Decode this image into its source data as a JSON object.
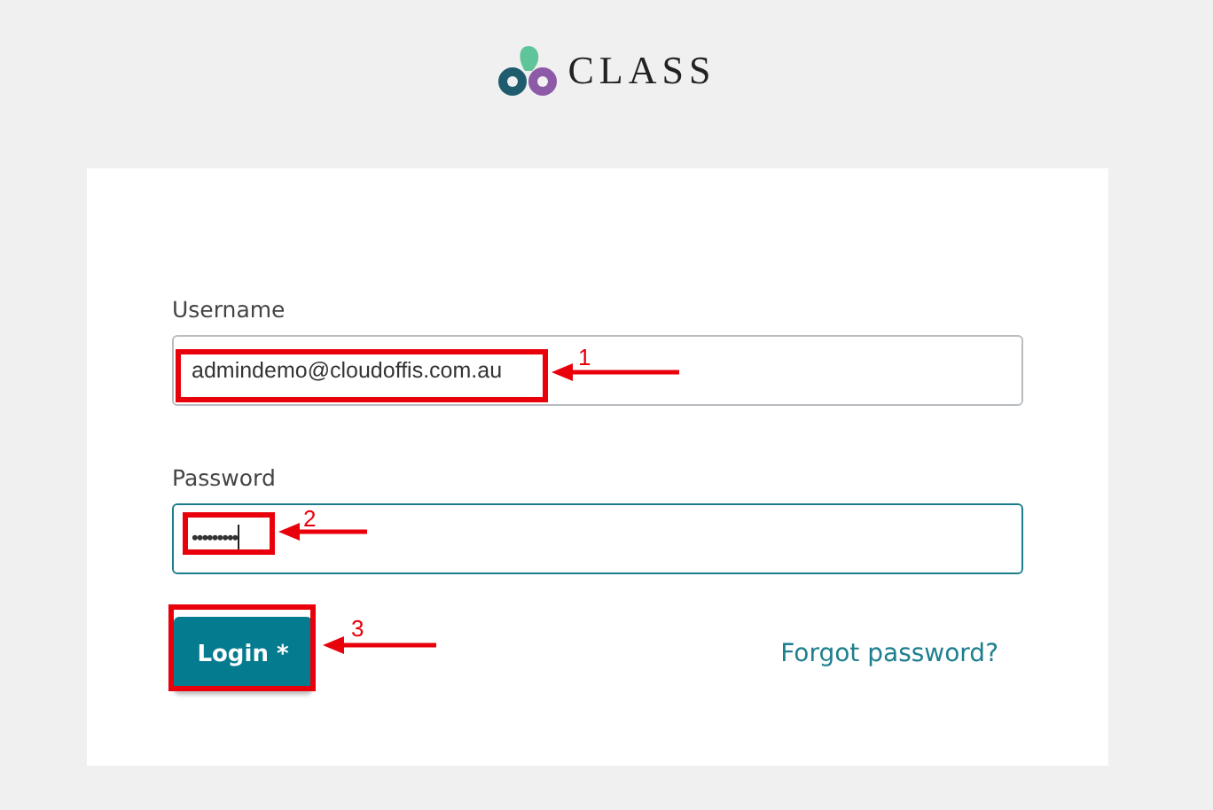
{
  "logo": {
    "text": "CLASS"
  },
  "fields": [
    {
      "label": "Username",
      "value": "admindemo@cloudoffis.com.au",
      "focused": false
    },
    {
      "label": "Password",
      "value": "•••••••••",
      "focused": true
    }
  ],
  "login_button": {
    "label": "Login *"
  },
  "forgot_link": {
    "label": "Forgot password?"
  },
  "annotations": [
    {
      "number": "1"
    },
    {
      "number": "2"
    },
    {
      "number": "3"
    }
  ]
}
